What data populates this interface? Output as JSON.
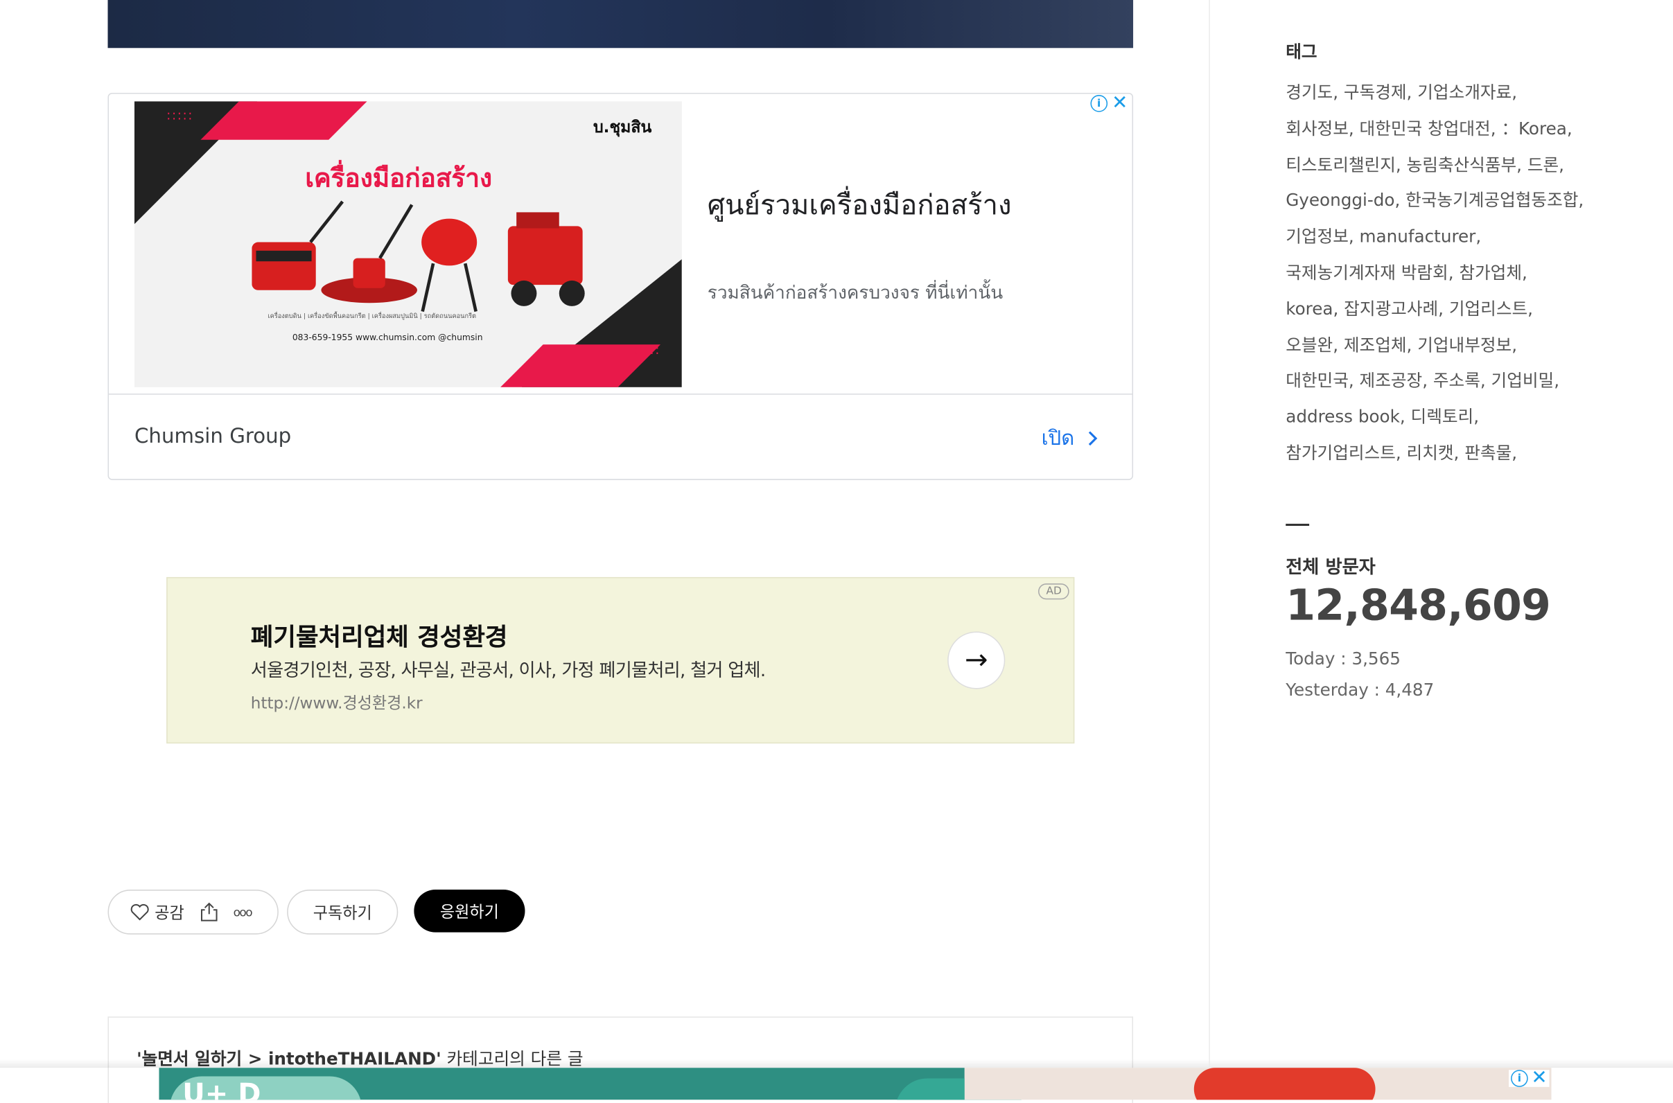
{
  "ad_card": {
    "image": {
      "brand": "บ.ชุมสิน",
      "headline": "เครื่องมือก่อสร้าง",
      "captions": "เครื่องตบดิน | เครื่องขัดพื้นคอนกรีต | เครื่องผสมปูนมินิ | รถตัดถนนคอนกรีต",
      "contact": "083-659-1955   www.chumsin.com   @chumsin"
    },
    "title": "ศูนย์รวมเครื่องมือก่อสร้าง",
    "description": "รวมสินค้าก่อสร้างครบวงจร ที่นี่เท่านั้น",
    "advertiser": "Chumsin Group",
    "open_label": "เปิด",
    "info_glyph": "i",
    "close_glyph": "✕"
  },
  "ad_banner": {
    "badge": "AD",
    "title": "폐기물처리업체 경성환경",
    "description": "서울경기인천, 공장, 사무실, 관공서, 이사, 가정 폐기물처리, 철거 업체.",
    "url": "http://www.경성환경.kr",
    "arrow_glyph": "→"
  },
  "reactions": {
    "like_label": "공감",
    "more_glyph": "ooo",
    "subscribe_label": "구독하기",
    "support_label": "응원하기"
  },
  "related": {
    "category": "'놀면서 일하기 > intotheTHAILAND'",
    "suffix": "카테고리의 다른 글"
  },
  "bottom_ad": {
    "text": "U+ D"
  },
  "sidebar": {
    "tags_title": "태그",
    "tags": [
      [
        "경기도",
        "구독경제",
        "기업소개자료"
      ],
      [
        "회사정보",
        "대한민국 창업대전",
        "：Korea"
      ],
      [
        "티스토리챌린지",
        "농림축산식품부",
        "드론"
      ],
      [
        "Gyeonggi-do",
        "한국농기계공업협동조합"
      ],
      [
        "기업정보",
        "manufacturer"
      ],
      [
        "국제농기계자재 박람회",
        "참가업체"
      ],
      [
        "korea",
        "잡지광고사례",
        "기업리스트"
      ],
      [
        "오블완",
        "제조업체",
        "기업내부정보"
      ],
      [
        "대한민국",
        "제조공장",
        "주소록",
        "기업비밀"
      ],
      [
        "address book",
        "디렉토리"
      ],
      [
        "참가기업리스트",
        "리치캣",
        "판촉물"
      ]
    ],
    "visitors_title": "전체 방문자",
    "visitors_total": "12,848,609",
    "today": "Today : 3,565",
    "yesterday": "Yesterday : 4,487"
  },
  "colors": {
    "ad_banner_bg": "#f3f4dc",
    "accent_link": "#1a73e8",
    "support_button_bg": "#000000"
  }
}
